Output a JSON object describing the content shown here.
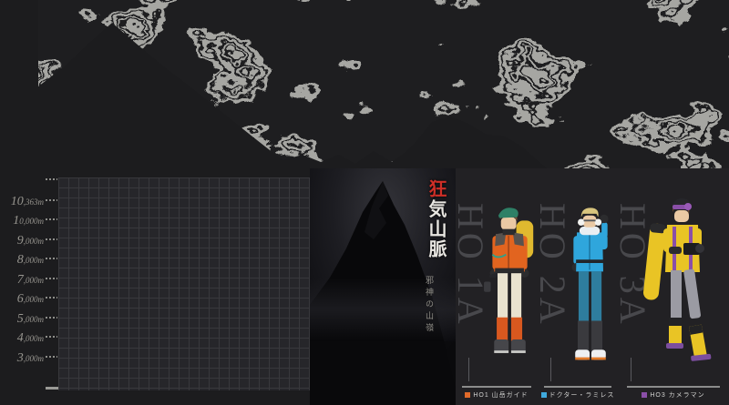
{
  "app": {
    "background": "#1c1c1e",
    "map_line_color": "#a6a6a2",
    "map_dark_color": "#1c1c1e"
  },
  "scale": {
    "unit": "m",
    "labels": [
      {
        "big": "10",
        "rest": ",363m"
      },
      {
        "big": "1",
        "rest": "0,000m"
      },
      {
        "big": "9",
        "rest": ",000m"
      },
      {
        "big": "8",
        "rest": ",000m"
      },
      {
        "big": "7",
        "rest": ",000m"
      },
      {
        "big": "6",
        "rest": ",000m"
      },
      {
        "big": "5",
        "rest": ",000m"
      },
      {
        "big": "4",
        "rest": ",000m"
      },
      {
        "big": "3",
        "rest": ",000m"
      }
    ]
  },
  "title_panel": {
    "title_first_char": "狂",
    "title_rest": "気山脈",
    "subtitle": "邪神の山嶺",
    "accent_color": "#cf2f27"
  },
  "characters": [
    {
      "ho": "HO 1A",
      "label": "HO1 山岳ガイド",
      "chip_color": "#e06a2a",
      "hat": "#2e8066",
      "jacket": "#e2641f",
      "shoulder": "#57524e",
      "pants": "#e9e2cf",
      "gaiter": "#d8581f",
      "boots": "#46464a",
      "pack": "#e0b92f"
    },
    {
      "ho": "HO 2A",
      "label": "ドクター・ラミレス",
      "chip_color": "#3fa9dc",
      "hair": "#d9c57e",
      "jacket": "#2fa6dc",
      "scarf": "#e9eef2",
      "pants": "#2e7d9e",
      "gaiter": "#3a3a3e",
      "shoes": "#eef0f2"
    },
    {
      "ho": "HO 3A",
      "label": "HO3 カメラマン",
      "chip_color": "#8a4fa8",
      "beanie": "#26262a",
      "goggles": "#8a4fa8",
      "jacket": "#e9c425",
      "strap": "#8a4fa8",
      "pants": "#9b9ba3",
      "boots": "#e9c425",
      "sole": "#7b4e9e",
      "camera": "#1d1d1f"
    }
  ]
}
